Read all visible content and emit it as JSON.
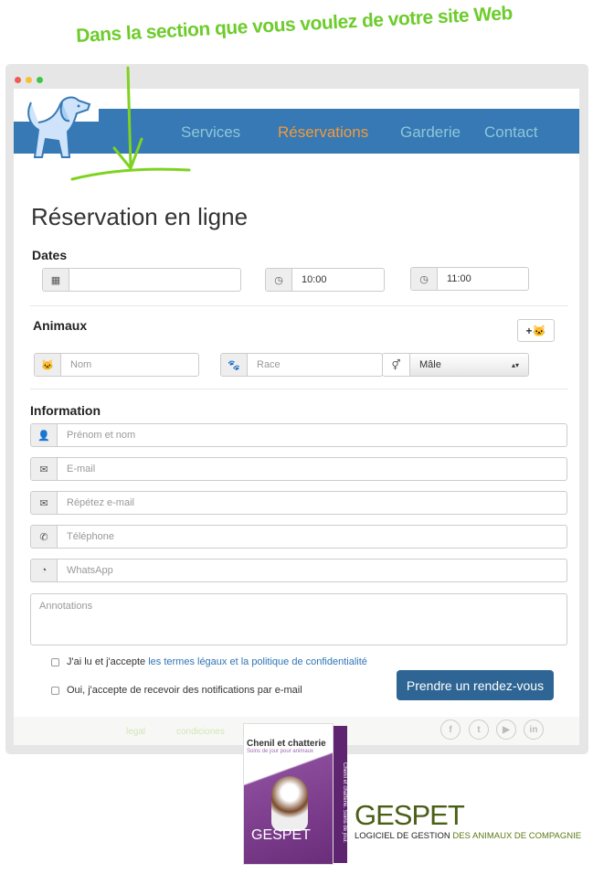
{
  "headline": "Dans la section que vous voulez de votre site Web",
  "nav": [
    {
      "label": "Services"
    },
    {
      "label": "Réservations",
      "active": true
    },
    {
      "label": "Garderie"
    },
    {
      "label": "Contact"
    }
  ],
  "form": {
    "title": "Réservation en ligne",
    "dates_label": "Dates",
    "date_value": "",
    "time_start": "10:00",
    "time_end": "11:00",
    "animals_label": "Animaux",
    "add_animal_icon": "plus-cat-icon",
    "name_placeholder": "Nom",
    "breed_placeholder": "Race",
    "sex_value": "Mâle",
    "info_label": "Information",
    "fullname_placeholder": "Prénom et nom",
    "email_placeholder": "E-mail",
    "email_repeat_placeholder": "Répétez e-mail",
    "phone_placeholder": "Téléphone",
    "whatsapp_placeholder": "WhatsApp",
    "notes_placeholder": "Annotations",
    "terms_prefix": "J'ai lu et j'accepte ",
    "terms_link": "les termes légaux et la politique de confidentialité",
    "notify_label": "Oui, j'accepte de recevoir des notifications par e-mail",
    "submit": "Prendre un rendez-vous"
  },
  "footer": {
    "links": [
      "legal",
      "condiciones"
    ],
    "social": [
      "facebook-icon",
      "twitter-icon",
      "youtube-icon",
      "linkedin-icon"
    ]
  },
  "product": {
    "box_title": "Chenil et chatterie",
    "box_subtitle": "Soins de jour pour animaux",
    "box_brand": "GESPET",
    "spine": "Chenil et chatterie. Soins de jour.",
    "brand": "GESPET",
    "tagline_a": "LOGICIEL DE GESTION ",
    "tagline_b": "DES ANIMAUX DE COMPAGNIE"
  },
  "colors": {
    "nav_bar": "#3679b5",
    "active": "#f29a3a",
    "button": "#2e6594",
    "annotation": "#6dcc2c",
    "box": "#7a3a8a"
  }
}
